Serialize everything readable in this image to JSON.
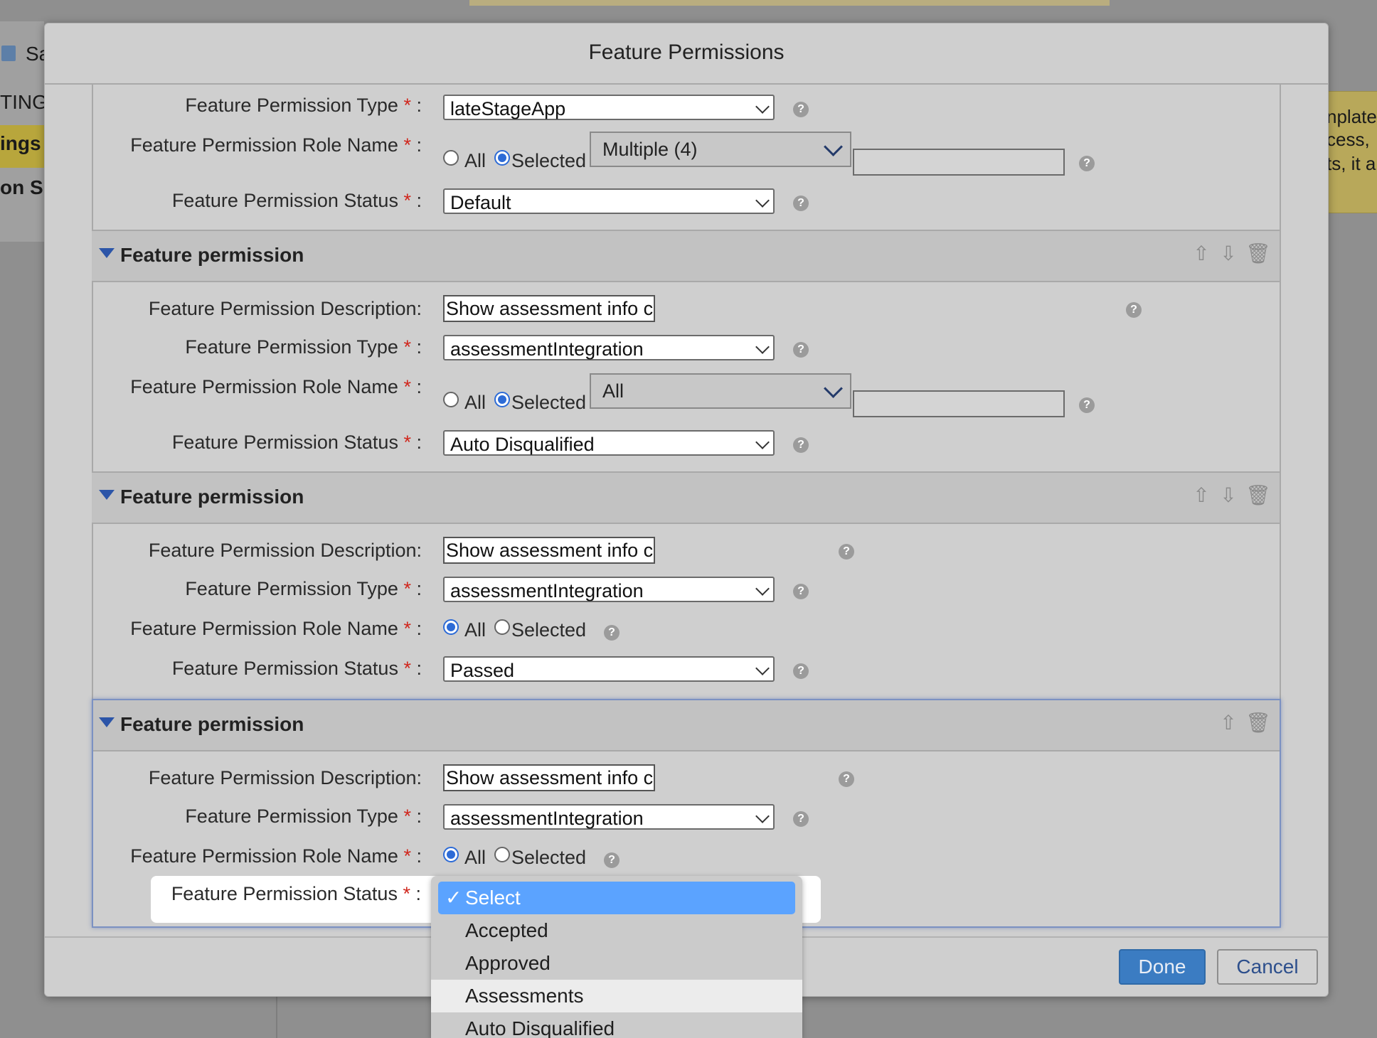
{
  "background": {
    "left_items": {
      "save": "Sa",
      "ting": "TING",
      "ings": "ings",
      "on_s": "on S"
    },
    "right_items": [
      "nplate",
      "cess,",
      "ts, it a"
    ]
  },
  "modal": {
    "title": "Feature Permissions",
    "section_title": "Feature permission",
    "required_mark": "*",
    "labels": {
      "description": "Feature Permission Description:",
      "type": "Feature Permission Type",
      "role_name": "Feature Permission Role Name",
      "status": "Feature Permission Status",
      "colon": " :"
    },
    "radio_labels": {
      "all": "All",
      "selected": "Selected"
    },
    "help_glyph": "?",
    "sections": [
      {
        "type": "lateStageApp",
        "role_mode": "Selected",
        "role_multiselect": "Multiple (4)",
        "status": "Default"
      },
      {
        "description": "Show assessment info c",
        "type": "assessmentIntegration",
        "role_mode": "Selected",
        "role_multiselect": "All",
        "status": "Auto Disqualified"
      },
      {
        "description": "Show assessment info c",
        "type": "assessmentIntegration",
        "role_mode": "All",
        "status": "Passed"
      },
      {
        "description": "Show assessment info c",
        "type": "assessmentIntegration",
        "role_mode": "All",
        "status": "Select"
      }
    ],
    "status_dropdown": {
      "check": "✓",
      "options": [
        "Select",
        "Accepted",
        "Approved",
        "Assessments",
        "Auto Disqualified"
      ],
      "selected": "Select",
      "hovered": "Assessments"
    },
    "buttons": {
      "done": "Done",
      "cancel": "Cancel"
    }
  }
}
